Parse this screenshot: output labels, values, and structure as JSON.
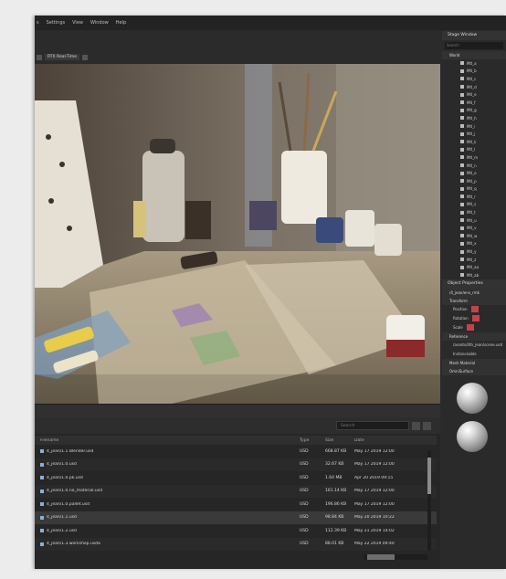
{
  "menu": [
    "s",
    "Settings",
    "View",
    "Window",
    "Help"
  ],
  "toolbar": {
    "view_chip": "RTX Real-Time"
  },
  "bottom": {
    "search_placeholder": "Search",
    "columns": [
      "Filename",
      "Type",
      "Size",
      "Date"
    ],
    "rows": [
      {
        "name": "4_jean/1.1 Blender.usd",
        "type": "USD",
        "size": "668.87 KB",
        "date": "May 17 2019 12:00"
      },
      {
        "name": "4_jean/1.0.usd",
        "type": "USD",
        "size": "32.67 KB",
        "date": "May 17 2019 12:00"
      },
      {
        "name": "4_jean/1.0.pk.usd",
        "type": "USD",
        "size": "1.64 MB",
        "date": "Apr 20 2019 09:15"
      },
      {
        "name": "4_jean/1.0.no_material.usd",
        "type": "USD",
        "size": "161.14 KB",
        "date": "May 17 2019 12:00"
      },
      {
        "name": "4_jean/1.0.pallet.usd",
        "type": "USD",
        "size": "196.86 KB",
        "date": "May 17 2019 12:00"
      },
      {
        "name": "4_jean/1.1.usd",
        "type": "USD",
        "size": "98.84 KB",
        "date": "May 20 2019 10:22"
      },
      {
        "name": "4_jean/1.2.usd",
        "type": "USD",
        "size": "112.39 KB",
        "date": "May 21 2019 14:02"
      },
      {
        "name": "4_jean/1.3.workshop.usda",
        "type": "USD",
        "size": "88.01 KB",
        "date": "May 22 2019 09:40"
      }
    ]
  },
  "right": {
    "stage_title": "Stage Window",
    "search_placeholder": "Search",
    "tree_root": "World",
    "tree_items": [
      "Mtl_a",
      "Mtl_b",
      "Mtl_c",
      "Mtl_d",
      "Mtl_e",
      "Mtl_f",
      "Mtl_g",
      "Mtl_h",
      "Mtl_i",
      "Mtl_j",
      "Mtl_k",
      "Mtl_l",
      "Mtl_m",
      "Mtl_n",
      "Mtl_o",
      "Mtl_p",
      "Mtl_q",
      "Mtl_r",
      "Mtl_s",
      "Mtl_t",
      "Mtl_u",
      "Mtl_v",
      "Mtl_w",
      "Mtl_x",
      "Mtl_y",
      "Mtl_z",
      "Mtl_aa",
      "Mtl_ab"
    ],
    "props_title": "Object Properties",
    "props_path": "/4_jean/env_rmk",
    "transform_label": "Transform",
    "position_label": "Position",
    "rotation_label": "Rotation",
    "scale_label": "Scale",
    "reference_label": "Reference",
    "reference_path": "/assets/4th_jean/scene.usd",
    "instanceable_label": "Instanceable",
    "material_title": "Mesh Material",
    "material_sub": "OmniSurface"
  },
  "colors": {
    "accent_red": "#c8414a",
    "panel": "#2a2a2a",
    "background": "#ececec"
  }
}
